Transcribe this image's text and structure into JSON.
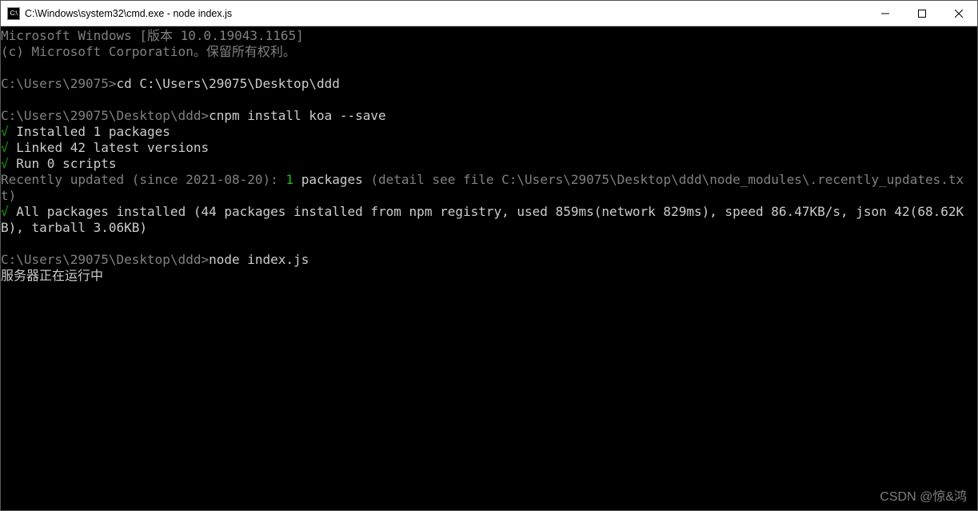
{
  "titlebar": {
    "icon_label": "C:\\",
    "title": "C:\\Windows\\system32\\cmd.exe - node  index.js"
  },
  "controls": {
    "minimize": "minimize",
    "maximize": "maximize",
    "close": "close"
  },
  "terminal": {
    "line1": "Microsoft Windows [版本 10.0.19043.1165]",
    "line2": "(c) Microsoft Corporation。保留所有权利。",
    "blank": "",
    "prompt1_path": "C:\\Users\\29075>",
    "prompt1_cmd": "cd C:\\Users\\29075\\Desktop\\ddd",
    "prompt2_path": "C:\\Users\\29075\\Desktop\\ddd>",
    "prompt2_cmd": "cnpm install koa --save",
    "check": "√",
    "installed_pkgs": " Installed 1 packages",
    "linked": " Linked 42 latest versions",
    "run_scripts": " Run 0 scripts",
    "recent_pre": "Recently updated (since 2021-08-20): ",
    "recent_count": "1",
    "recent_word": " packages ",
    "recent_post": "(detail see file C:\\Users\\29075\\Desktop\\ddd\\node_modules\\.recently_updates.txt)",
    "all_installed": " All packages installed (44 packages installed from npm registry, used 859ms(network 829ms), speed 86.47KB/s, json 42(68.62KB), tarball 3.06KB)",
    "prompt3_path": "C:\\Users\\29075\\Desktop\\ddd>",
    "prompt3_cmd": "node index.js",
    "server_msg": "服务器正在运行中"
  },
  "watermark": "CSDN @惊&鸿"
}
